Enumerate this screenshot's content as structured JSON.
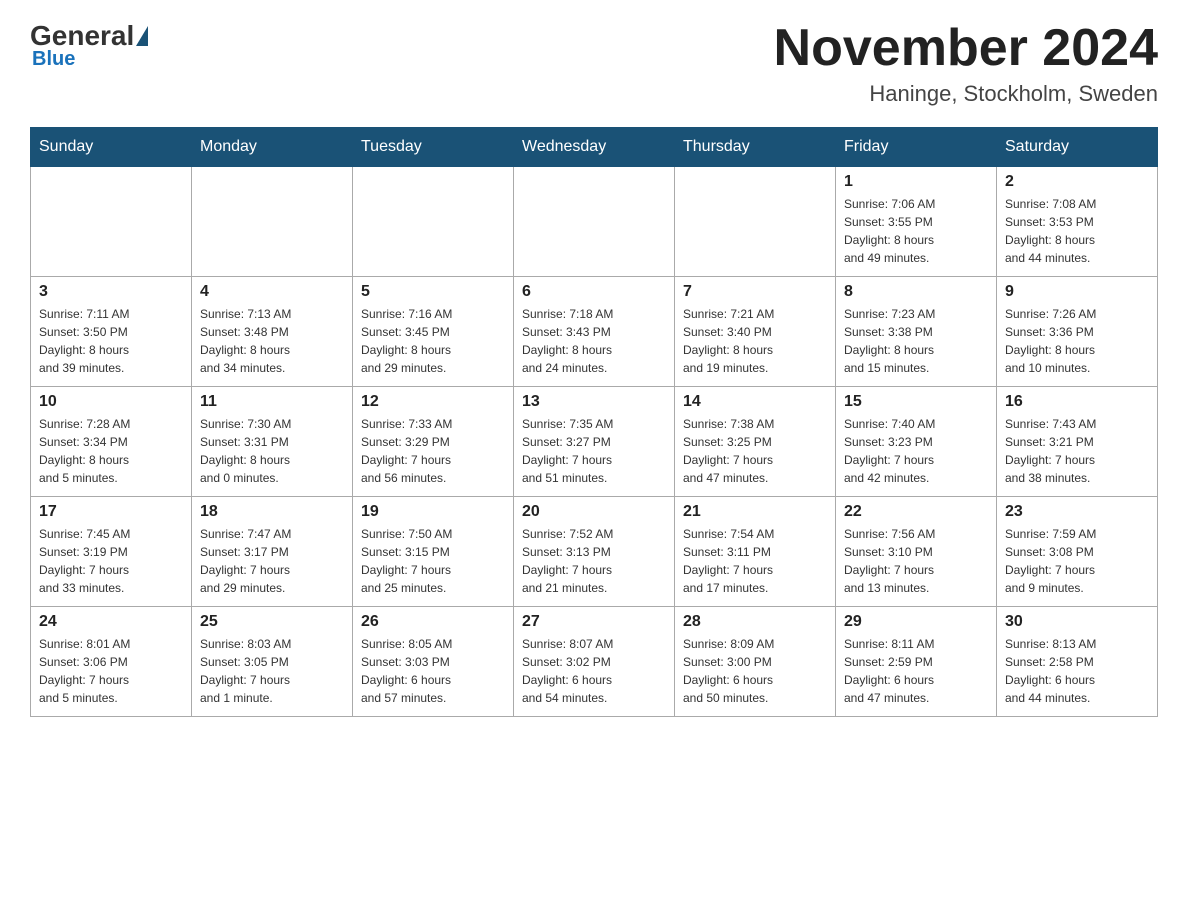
{
  "header": {
    "logo": {
      "general": "General",
      "blue": "Blue"
    },
    "title": "November 2024",
    "location": "Haninge, Stockholm, Sweden"
  },
  "weekdays": [
    "Sunday",
    "Monday",
    "Tuesday",
    "Wednesday",
    "Thursday",
    "Friday",
    "Saturday"
  ],
  "weeks": [
    [
      {
        "day": "",
        "info": ""
      },
      {
        "day": "",
        "info": ""
      },
      {
        "day": "",
        "info": ""
      },
      {
        "day": "",
        "info": ""
      },
      {
        "day": "",
        "info": ""
      },
      {
        "day": "1",
        "info": "Sunrise: 7:06 AM\nSunset: 3:55 PM\nDaylight: 8 hours\nand 49 minutes."
      },
      {
        "day": "2",
        "info": "Sunrise: 7:08 AM\nSunset: 3:53 PM\nDaylight: 8 hours\nand 44 minutes."
      }
    ],
    [
      {
        "day": "3",
        "info": "Sunrise: 7:11 AM\nSunset: 3:50 PM\nDaylight: 8 hours\nand 39 minutes."
      },
      {
        "day": "4",
        "info": "Sunrise: 7:13 AM\nSunset: 3:48 PM\nDaylight: 8 hours\nand 34 minutes."
      },
      {
        "day": "5",
        "info": "Sunrise: 7:16 AM\nSunset: 3:45 PM\nDaylight: 8 hours\nand 29 minutes."
      },
      {
        "day": "6",
        "info": "Sunrise: 7:18 AM\nSunset: 3:43 PM\nDaylight: 8 hours\nand 24 minutes."
      },
      {
        "day": "7",
        "info": "Sunrise: 7:21 AM\nSunset: 3:40 PM\nDaylight: 8 hours\nand 19 minutes."
      },
      {
        "day": "8",
        "info": "Sunrise: 7:23 AM\nSunset: 3:38 PM\nDaylight: 8 hours\nand 15 minutes."
      },
      {
        "day": "9",
        "info": "Sunrise: 7:26 AM\nSunset: 3:36 PM\nDaylight: 8 hours\nand 10 minutes."
      }
    ],
    [
      {
        "day": "10",
        "info": "Sunrise: 7:28 AM\nSunset: 3:34 PM\nDaylight: 8 hours\nand 5 minutes."
      },
      {
        "day": "11",
        "info": "Sunrise: 7:30 AM\nSunset: 3:31 PM\nDaylight: 8 hours\nand 0 minutes."
      },
      {
        "day": "12",
        "info": "Sunrise: 7:33 AM\nSunset: 3:29 PM\nDaylight: 7 hours\nand 56 minutes."
      },
      {
        "day": "13",
        "info": "Sunrise: 7:35 AM\nSunset: 3:27 PM\nDaylight: 7 hours\nand 51 minutes."
      },
      {
        "day": "14",
        "info": "Sunrise: 7:38 AM\nSunset: 3:25 PM\nDaylight: 7 hours\nand 47 minutes."
      },
      {
        "day": "15",
        "info": "Sunrise: 7:40 AM\nSunset: 3:23 PM\nDaylight: 7 hours\nand 42 minutes."
      },
      {
        "day": "16",
        "info": "Sunrise: 7:43 AM\nSunset: 3:21 PM\nDaylight: 7 hours\nand 38 minutes."
      }
    ],
    [
      {
        "day": "17",
        "info": "Sunrise: 7:45 AM\nSunset: 3:19 PM\nDaylight: 7 hours\nand 33 minutes."
      },
      {
        "day": "18",
        "info": "Sunrise: 7:47 AM\nSunset: 3:17 PM\nDaylight: 7 hours\nand 29 minutes."
      },
      {
        "day": "19",
        "info": "Sunrise: 7:50 AM\nSunset: 3:15 PM\nDaylight: 7 hours\nand 25 minutes."
      },
      {
        "day": "20",
        "info": "Sunrise: 7:52 AM\nSunset: 3:13 PM\nDaylight: 7 hours\nand 21 minutes."
      },
      {
        "day": "21",
        "info": "Sunrise: 7:54 AM\nSunset: 3:11 PM\nDaylight: 7 hours\nand 17 minutes."
      },
      {
        "day": "22",
        "info": "Sunrise: 7:56 AM\nSunset: 3:10 PM\nDaylight: 7 hours\nand 13 minutes."
      },
      {
        "day": "23",
        "info": "Sunrise: 7:59 AM\nSunset: 3:08 PM\nDaylight: 7 hours\nand 9 minutes."
      }
    ],
    [
      {
        "day": "24",
        "info": "Sunrise: 8:01 AM\nSunset: 3:06 PM\nDaylight: 7 hours\nand 5 minutes."
      },
      {
        "day": "25",
        "info": "Sunrise: 8:03 AM\nSunset: 3:05 PM\nDaylight: 7 hours\nand 1 minute."
      },
      {
        "day": "26",
        "info": "Sunrise: 8:05 AM\nSunset: 3:03 PM\nDaylight: 6 hours\nand 57 minutes."
      },
      {
        "day": "27",
        "info": "Sunrise: 8:07 AM\nSunset: 3:02 PM\nDaylight: 6 hours\nand 54 minutes."
      },
      {
        "day": "28",
        "info": "Sunrise: 8:09 AM\nSunset: 3:00 PM\nDaylight: 6 hours\nand 50 minutes."
      },
      {
        "day": "29",
        "info": "Sunrise: 8:11 AM\nSunset: 2:59 PM\nDaylight: 6 hours\nand 47 minutes."
      },
      {
        "day": "30",
        "info": "Sunrise: 8:13 AM\nSunset: 2:58 PM\nDaylight: 6 hours\nand 44 minutes."
      }
    ]
  ]
}
